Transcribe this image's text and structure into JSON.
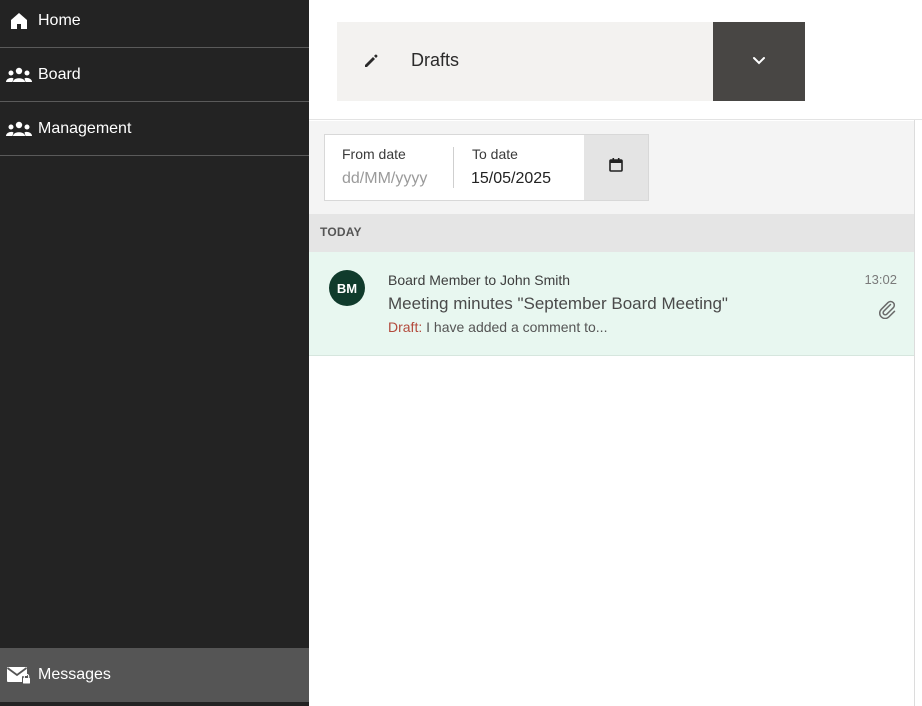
{
  "sidebar": {
    "items": [
      {
        "label": "Home",
        "icon": "home-icon"
      },
      {
        "label": "Board",
        "icon": "group-icon"
      },
      {
        "label": "Management",
        "icon": "group-icon"
      }
    ],
    "bottom_item": {
      "label": "Messages",
      "icon": "mail-lock-icon",
      "active": true
    }
  },
  "folder": {
    "icon": "pencil-icon",
    "label": "Drafts",
    "dropdown_icon": "chevron-down-icon"
  },
  "filter": {
    "from_label": "From date",
    "from_placeholder": "dd/MM/yyyy",
    "to_label": "To date",
    "to_value": "15/05/2025",
    "calendar_icon": "calendar-icon"
  },
  "messages": {
    "group_label": "TODAY",
    "items": [
      {
        "avatar": "BM",
        "from": "Board Member to John Smith",
        "subject": "Meeting minutes \"September Board Meeting\"",
        "draft_tag": "Draft:",
        "preview": " I have added a comment to...",
        "time": "13:02",
        "has_attachment": true
      }
    ]
  },
  "colors": {
    "sidebar_bg": "#232323",
    "sidebar_active_bg": "#555555",
    "avatar_bg": "#103b2c",
    "row_highlight": "#e8f7f0",
    "draft_red": "#b34a3c"
  }
}
